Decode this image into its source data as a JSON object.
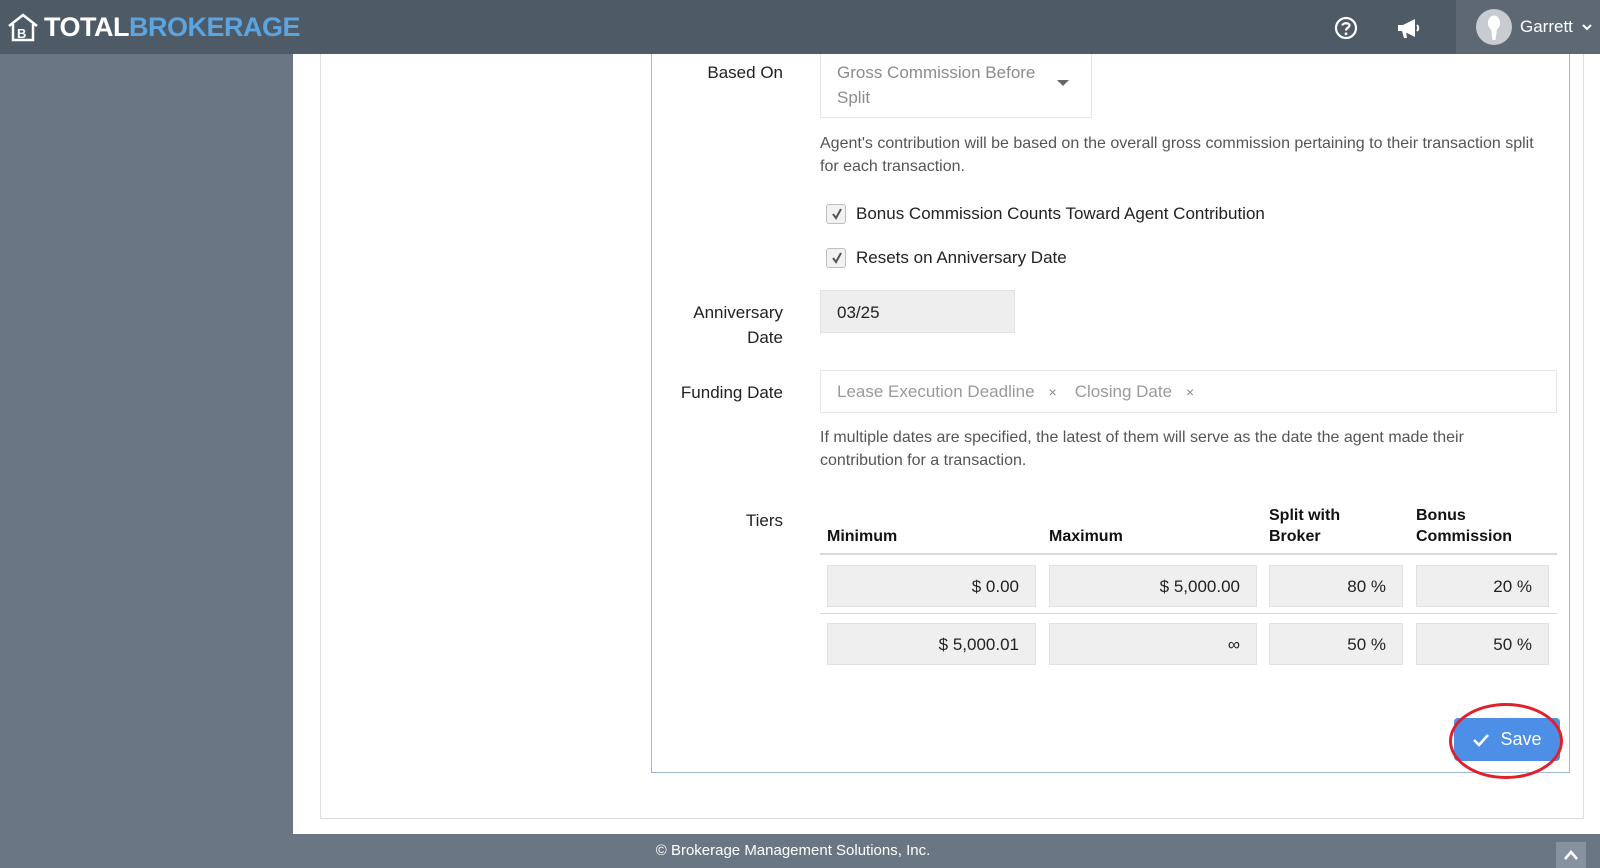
{
  "header": {
    "logo_total": "TOTAL",
    "logo_brokerage": "BROKERAGE",
    "help_icon": "help-circle-icon",
    "announce_icon": "megaphone-icon",
    "user_name": "Garrett"
  },
  "form": {
    "based_on": {
      "label": "Based On",
      "value": "Gross Commission Before Split",
      "help": "Agent's contribution will be based on the overall gross commission pertaining to their transaction split for each transaction."
    },
    "checkboxes": [
      {
        "label": "Bonus Commission Counts Toward Agent Contribution",
        "checked": true
      },
      {
        "label": "Resets on Anniversary Date",
        "checked": true
      }
    ],
    "anniversary": {
      "label": "Anniversary Date",
      "value": "03/25"
    },
    "funding": {
      "label": "Funding Date",
      "tags": [
        "Lease Execution Deadline",
        "Closing Date"
      ],
      "tag_remove": "×",
      "help": "If multiple dates are specified, the latest of them will serve as the date the agent made their contribution for a transaction."
    },
    "tiers": {
      "label": "Tiers",
      "columns": [
        "Minimum",
        "Maximum",
        "Split with Broker",
        "Bonus Commission"
      ],
      "rows": [
        [
          "$ 0.00",
          "$ 5,000.00",
          "80 %",
          "20 %"
        ],
        [
          "$ 5,000.01",
          "∞",
          "50 %",
          "50 %"
        ]
      ]
    },
    "save_label": "Save"
  },
  "footer": {
    "text": "© Brokerage Management Solutions, Inc."
  },
  "colors": {
    "topbar": "#4e5a66",
    "sidebar": "#6a7683",
    "accent": "#4d8ee6",
    "highlight": "#e0202a"
  }
}
